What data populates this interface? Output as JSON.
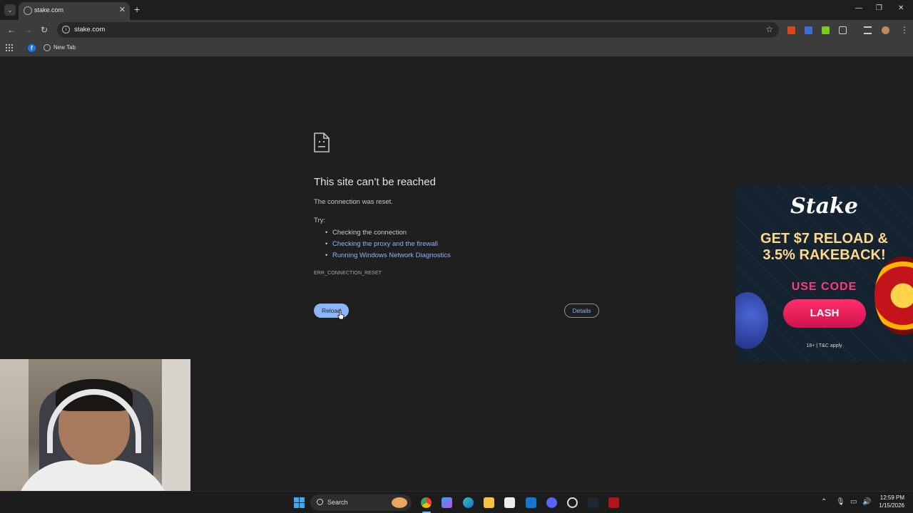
{
  "browser": {
    "tab_title": "stake.com",
    "url": "stake.com",
    "bookmark_label": "New Tab",
    "tab_close_glyph": "✕",
    "new_tab_glyph": "+",
    "window_controls": [
      "—",
      "❐",
      "✕"
    ]
  },
  "error_page": {
    "title": "This site can’t be reached",
    "message": "The connection was reset.",
    "try_label": "Try:",
    "suggestions": [
      {
        "label": "Checking the connection",
        "link": false
      },
      {
        "label": "Checking the proxy and the firewall",
        "link": true
      },
      {
        "label": "Running Windows Network Diagnostics",
        "link": true
      }
    ],
    "error_code": "ERR_CONNECTION_RESET",
    "reload_label": "Reload",
    "details_label": "Details"
  },
  "ad": {
    "brand": "Stake",
    "headline_line1": "GET $7 RELOAD &",
    "headline_line2": "3.5% RAKEBACK!",
    "code_label": "USE CODE",
    "code": "LASH",
    "terms": "18+ | T&C apply"
  },
  "taskbar": {
    "search_label": "Search",
    "time": "12:59 PM",
    "date": "1/15/2026"
  },
  "colors": {
    "page_bg": "#1f1f1f",
    "link": "#8ab4f8",
    "reload_button": "#8ab4f8",
    "ad_code_button": "#e01a55",
    "ad_headline": "#ffd98a"
  }
}
